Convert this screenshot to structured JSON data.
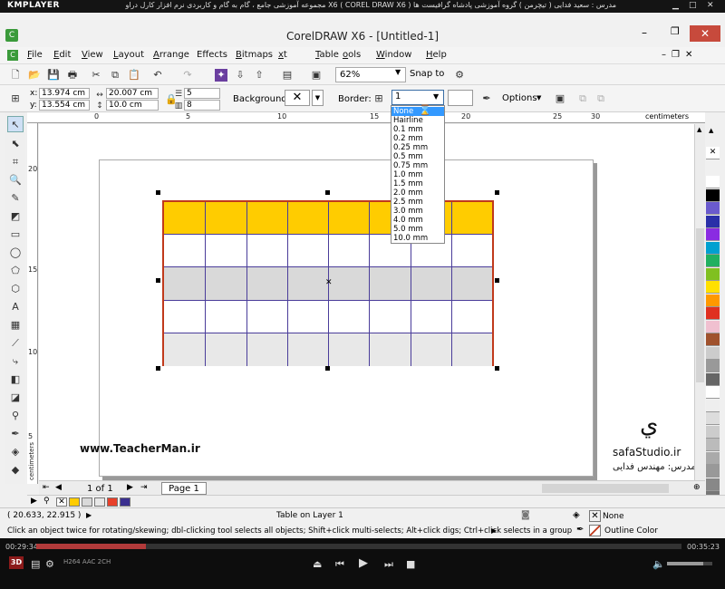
{
  "player": {
    "logo": "KMPLAYER",
    "video_title": "مجموعه آموزشی جامع ، گام به گام و کاربردی نرم افزار کارل دراو X6 ( COREL DRAW X6 )  مدرس : سعید فدایی ( تیچرمن ) گروه آموزشی پادشاه گرافیست ها",
    "time_elapsed": "00:29:34",
    "time_total": "00:35:23",
    "progress_fraction": 0.17,
    "volume_fraction": 0.8,
    "codecs": "H264  AAC  2CH",
    "badge_3d": "3D"
  },
  "app": {
    "title": "CorelDRAW X6 - [Untitled-1]",
    "icon_letter": "C"
  },
  "menu": [
    {
      "label": "File",
      "ul": "F",
      "rest": "ile"
    },
    {
      "label": "Edit",
      "ul": "E",
      "rest": "dit"
    },
    {
      "label": "View",
      "ul": "V",
      "rest": "iew"
    },
    {
      "label": "Layout",
      "ul": "L",
      "rest": "ayout"
    },
    {
      "label": "Arrange",
      "ul": "A",
      "rest": "rrange"
    },
    {
      "label": "Effects",
      "ul": "C",
      "rest": "ts"
    },
    {
      "label": "Bitmaps",
      "ul": "B",
      "rest": "itmaps"
    },
    {
      "label": "Text",
      "ul": "x",
      "rest": "t"
    },
    {
      "label": "Table",
      "ul": "T",
      "rest": "able"
    },
    {
      "label": "Tools",
      "ul": "o",
      "rest": "ols"
    },
    {
      "label": "Window",
      "ul": "W",
      "rest": "indow"
    },
    {
      "label": "Help",
      "ul": "H",
      "rest": "elp"
    }
  ],
  "toolbar": {
    "zoom": "62%",
    "snap_to": "Snap to"
  },
  "propbar": {
    "x": "13.974 cm",
    "y": "13.554 cm",
    "width": "20.007 cm",
    "height": "10.0 cm",
    "rows": "5",
    "cols": "8",
    "x_label": "x:",
    "y_label": "y:",
    "background_label": "Background:",
    "border_label": "Border:",
    "border_value": "1",
    "options_label": "Options"
  },
  "border_dropdown": [
    "None",
    "Hairline",
    "0.1 mm",
    "0.2 mm",
    "0.25 mm",
    "0.5 mm",
    "0.75 mm",
    "1.0 mm",
    "1.5 mm",
    "2.0 mm",
    "2.5 mm",
    "3.0 mm",
    "4.0 mm",
    "5.0 mm",
    "10.0 mm"
  ],
  "border_dropdown_selected": 0,
  "ruler": {
    "units": "centimeters",
    "top": [
      "0",
      "5",
      "10",
      "15",
      "20",
      "25",
      "30"
    ],
    "left": [
      "20",
      "15",
      "10",
      "5"
    ],
    "left_units": "centimeters"
  },
  "table": {
    "rows": 5,
    "cols": 8,
    "row_colors": [
      "#ffcc00",
      "#ffffff",
      "#d9d9d9",
      "#ffffff",
      "#e8e8e8"
    ],
    "border_color": "#c0391b",
    "grid_color": "#4a3d9a"
  },
  "watermark": {
    "url": "www.TeacherMan.ir",
    "studio": "safaStudio.ir",
    "teacher": "مدرس: مهندس فدایی"
  },
  "page_nav": {
    "count": "1 of 1",
    "tab": "Page 1"
  },
  "doc_palette": [
    "#ffcc00",
    "#d9d9d9",
    "#e8e8e8",
    "#e8402a",
    "#3a2f8f"
  ],
  "color_palette": [
    "#ffffff",
    "#000000",
    "#6a5acd",
    "#2a2fa8",
    "#8a2be2",
    "#00a0d0",
    "#20b060",
    "#80c020",
    "#ffe000",
    "#ff9900",
    "#e03020",
    "#f0c0d0",
    "#a0522d",
    "#cccccc",
    "#999999",
    "#666666",
    "#ffffff",
    "#eeeeee",
    "#dddddd",
    "#cccccc",
    "#bbbbbb",
    "#aaaaaa",
    "#999999",
    "#888888",
    "#777777",
    "#666666"
  ],
  "status": {
    "coords": "( 20.633, 22.915 )",
    "object": "Table on Layer 1",
    "hint": "Click an object twice for rotating/skewing; dbl-clicking tool selects all objects; Shift+click multi-selects; Alt+click digs; Ctrl+click selects in a group",
    "fill": "None",
    "outline": "Outline Color"
  }
}
